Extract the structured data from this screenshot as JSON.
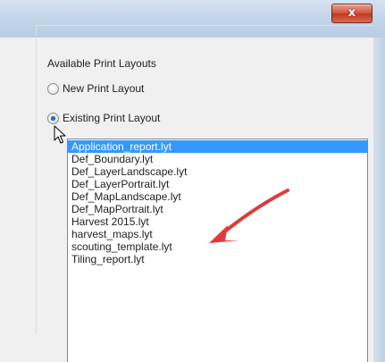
{
  "window": {
    "close_glyph": "x"
  },
  "print_layouts": {
    "group_title": "Available Print Layouts",
    "options": [
      {
        "label": "New Print Layout",
        "selected": false
      },
      {
        "label": "Existing Print Layout",
        "selected": true
      }
    ],
    "files": [
      "Application_report.lyt",
      "Def_Boundary.lyt",
      "Def_LayerLandscape.lyt",
      "Def_LayerPortrait.lyt",
      "Def_MapLandscape.lyt",
      "Def_MapPortrait.lyt",
      "Harvest 2015.lyt",
      "harvest_maps.lyt",
      "scouting_template.lyt",
      "Tiling_report.lyt"
    ],
    "selected_file_index": 0
  },
  "colors": {
    "selection": "#3399ff",
    "annotation_arrow": "#e03a3a",
    "close_button": "#c23a22"
  },
  "icons": {
    "cursor": "mouse-pointer-icon",
    "close": "close-icon",
    "annotation": "red-arrow-annotation-icon"
  }
}
